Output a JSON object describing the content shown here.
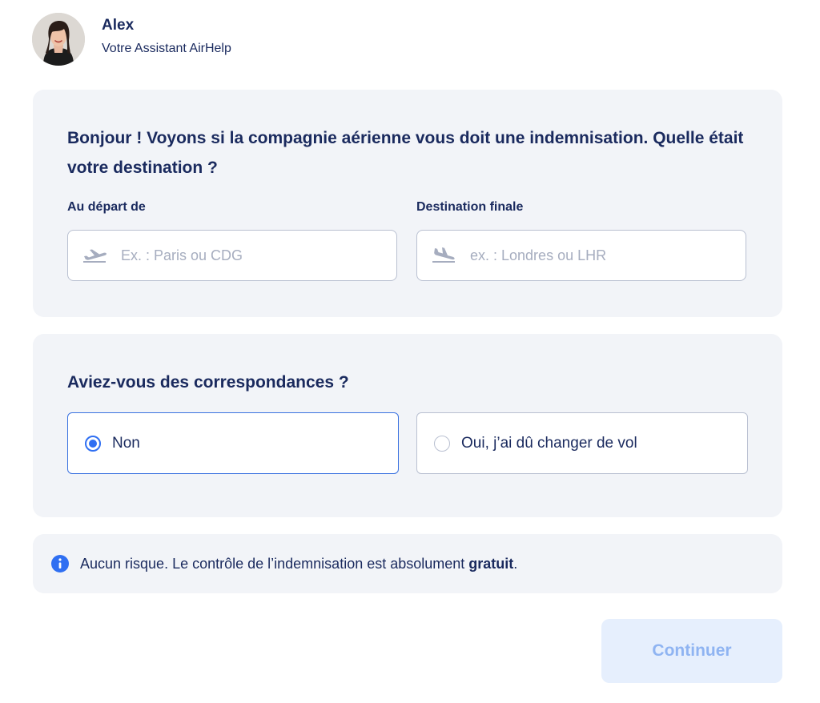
{
  "agent": {
    "name": "Alex",
    "role": "Votre Assistant AirHelp"
  },
  "route": {
    "question": "Bonjour ! Voyons si la compagnie aérienne vous doit une indemnisation. Quelle était votre destination ?",
    "departure": {
      "label": "Au départ de",
      "placeholder": "Ex. : Paris ou CDG",
      "value": "",
      "icon": "plane-takeoff-icon"
    },
    "destination": {
      "label": "Destination finale",
      "placeholder": "ex. : Londres ou LHR",
      "value": "",
      "icon": "plane-landing-icon"
    }
  },
  "connections": {
    "question": "Aviez-vous des correspondances ?",
    "options": [
      {
        "label": "Non",
        "selected": true
      },
      {
        "label": "Oui, j’ai dû changer de vol",
        "selected": false
      }
    ]
  },
  "info": {
    "text_before": "Aucun risque. Le contrôle de l’indemnisation est absolument ",
    "text_bold": "gratuit",
    "text_after": ".",
    "icon": "info-icon"
  },
  "actions": {
    "continue_label": "Continuer"
  },
  "colors": {
    "primary_text": "#1a2a5e",
    "accent": "#2f6ff2",
    "card_bg": "#f2f4f8",
    "button_bg_disabled": "#e6effd",
    "button_text_disabled": "#8fb4f2"
  }
}
